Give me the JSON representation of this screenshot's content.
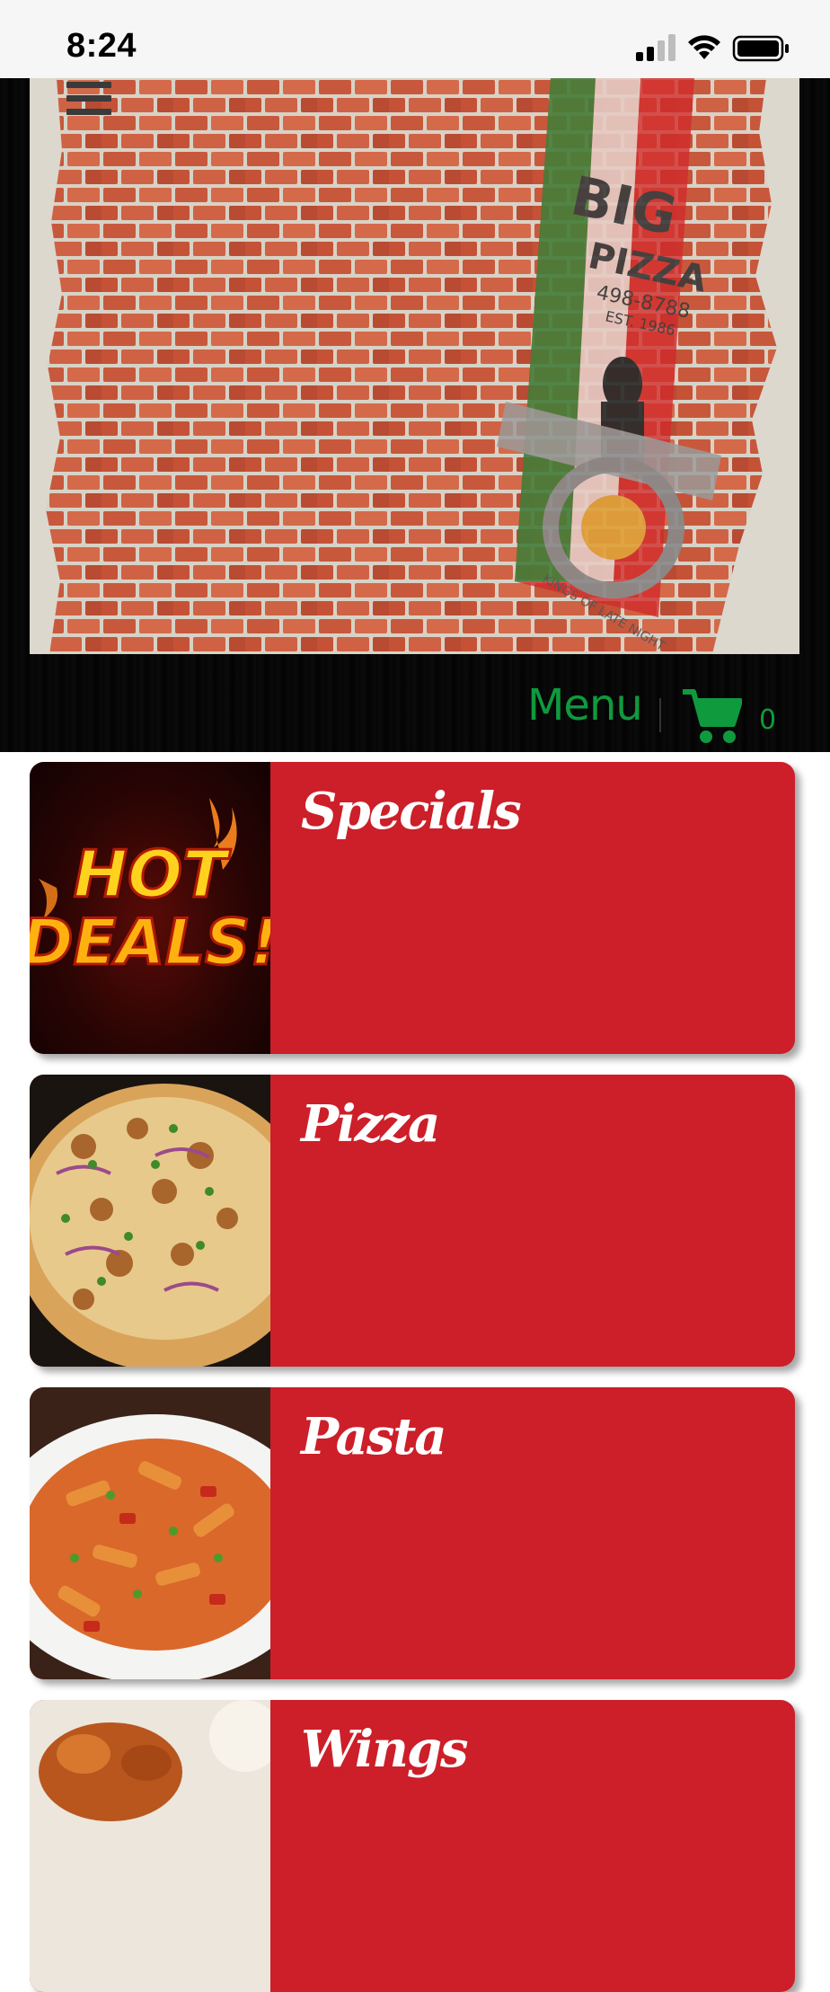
{
  "status_bar": {
    "time": "8:24"
  },
  "header": {
    "menu_label": "Menu",
    "cart_count": "0",
    "accent_color": "#0f9a3e"
  },
  "hero": {
    "logo_brand": "BIG",
    "logo_word": "PIZZA",
    "logo_phone": "498-8788",
    "logo_est": "EST. 1986",
    "logo_ribbon": "KINGS OF LATE NIGHT"
  },
  "categories": [
    {
      "label": "Specials",
      "image": "hot-deals-image",
      "image_text_1": "HOT",
      "image_text_2": "DEALS!"
    },
    {
      "label": "Pizza",
      "image": "pizza-image"
    },
    {
      "label": "Pasta",
      "image": "pasta-image"
    },
    {
      "label": "Wings",
      "image": "wings-image"
    }
  ],
  "card_color": "#cc1f29"
}
